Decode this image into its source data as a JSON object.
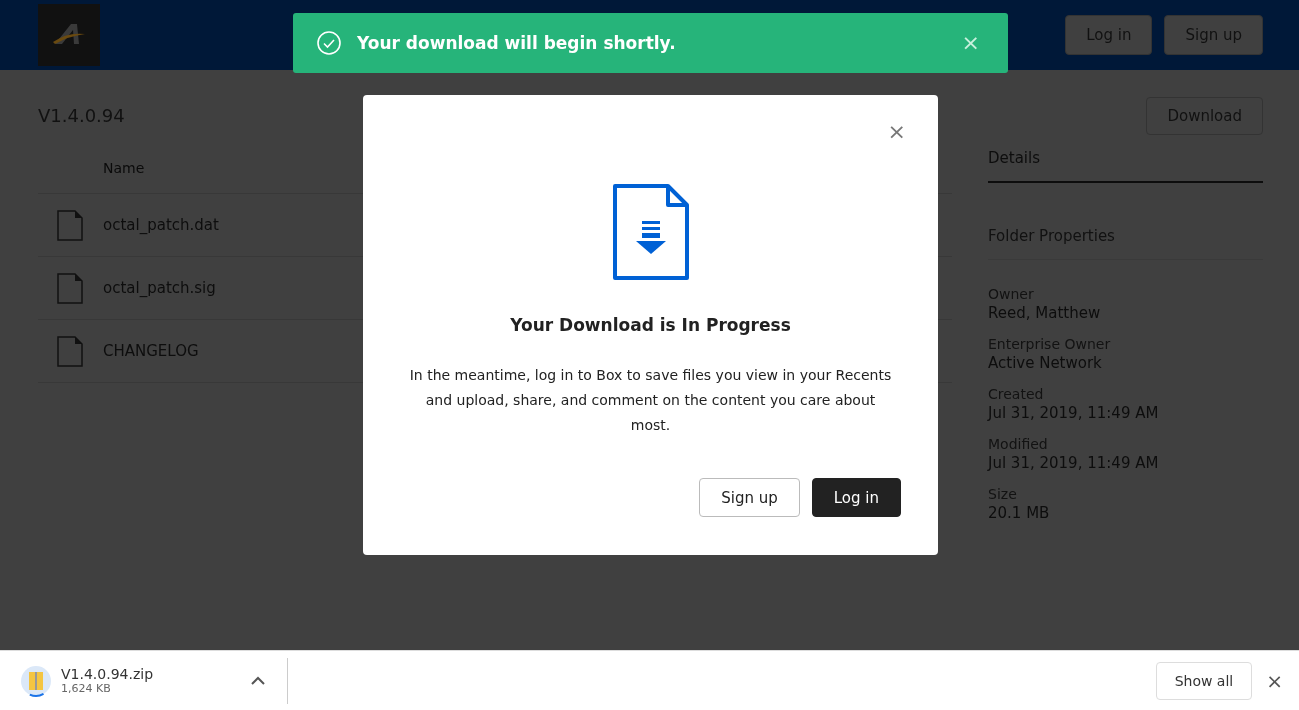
{
  "header": {
    "buttons": [
      "Log in",
      "Sign up"
    ]
  },
  "toast": {
    "message": "Your download will begin shortly.",
    "close": "×"
  },
  "folder": {
    "title": "V1.4.0.94",
    "download_button": "Download",
    "column": "Name",
    "files": [
      {
        "name": "octal_patch.dat"
      },
      {
        "name": "octal_patch.sig"
      },
      {
        "name": "CHANGELOG"
      }
    ]
  },
  "details": {
    "tab": "Details",
    "section": "Folder Properties",
    "properties": [
      {
        "label": "Owner",
        "value": "Reed, Matthew"
      },
      {
        "label": "Enterprise Owner",
        "value": "Active Network"
      },
      {
        "label": "Created",
        "value": "Jul 31, 2019, 11:49 AM"
      },
      {
        "label": "Modified",
        "value": "Jul 31, 2019, 11:49 AM"
      },
      {
        "label": "Size",
        "value": "20.1 MB"
      }
    ]
  },
  "modal": {
    "title": "Your Download is In Progress",
    "body": "In the meantime, log in to Box to save files you view in your Recents and upload, share, and comment on the content you care about most.",
    "close": "×",
    "buttons": [
      {
        "label": "Sign up",
        "kind": "secondary"
      },
      {
        "label": "Log in",
        "kind": "primary"
      }
    ]
  },
  "download_bar": {
    "file": "V1.4.0.94.zip",
    "size": "1,624 KB",
    "level": 0.15,
    "show_all": "Show all",
    "close": "×"
  }
}
